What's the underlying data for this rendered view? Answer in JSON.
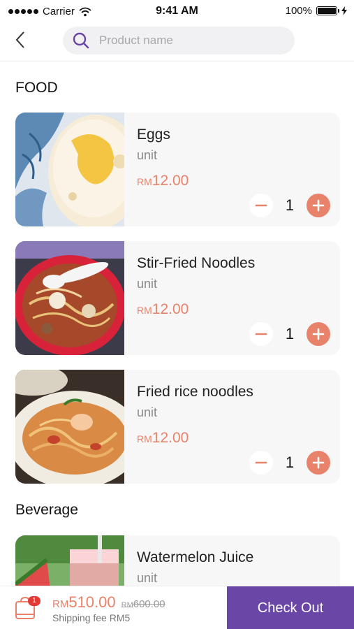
{
  "status_bar": {
    "carrier": "Carrier",
    "time": "9:41 AM",
    "battery": "100%"
  },
  "header": {
    "back_icon": "chevron-left-icon",
    "search": {
      "icon": "search-icon",
      "placeholder": "Product name",
      "value": ""
    }
  },
  "sections": [
    {
      "title": "FOOD",
      "items": [
        {
          "name": "Eggs",
          "unit": "unit",
          "currency": "RM",
          "price": "12.00",
          "quantity": "1",
          "image": "fried-egg-photo"
        },
        {
          "name": "Stir-Fried Noodles",
          "unit": "unit",
          "currency": "RM",
          "price": "12.00",
          "quantity": "1",
          "image": "noodle-soup-photo"
        },
        {
          "name": "Fried rice noodles",
          "unit": "unit",
          "currency": "RM",
          "price": "12.00",
          "quantity": "1",
          "image": "fried-noodles-photo"
        }
      ]
    },
    {
      "title": "Beverage",
      "items": [
        {
          "name": "Watermelon Juice",
          "unit": "unit",
          "currency": "RM",
          "price": "",
          "quantity": "",
          "image": "watermelon-juice-photo"
        }
      ]
    }
  ],
  "cart": {
    "badge_count": "1",
    "currency": "RM",
    "total": "510.00",
    "original_total": "600.00",
    "shipping_text": "Shipping fee RM5",
    "checkout_label": "Check Out"
  },
  "colors": {
    "accent": "#e9826a",
    "checkout": "#6a46a6",
    "badge": "#e53935"
  }
}
